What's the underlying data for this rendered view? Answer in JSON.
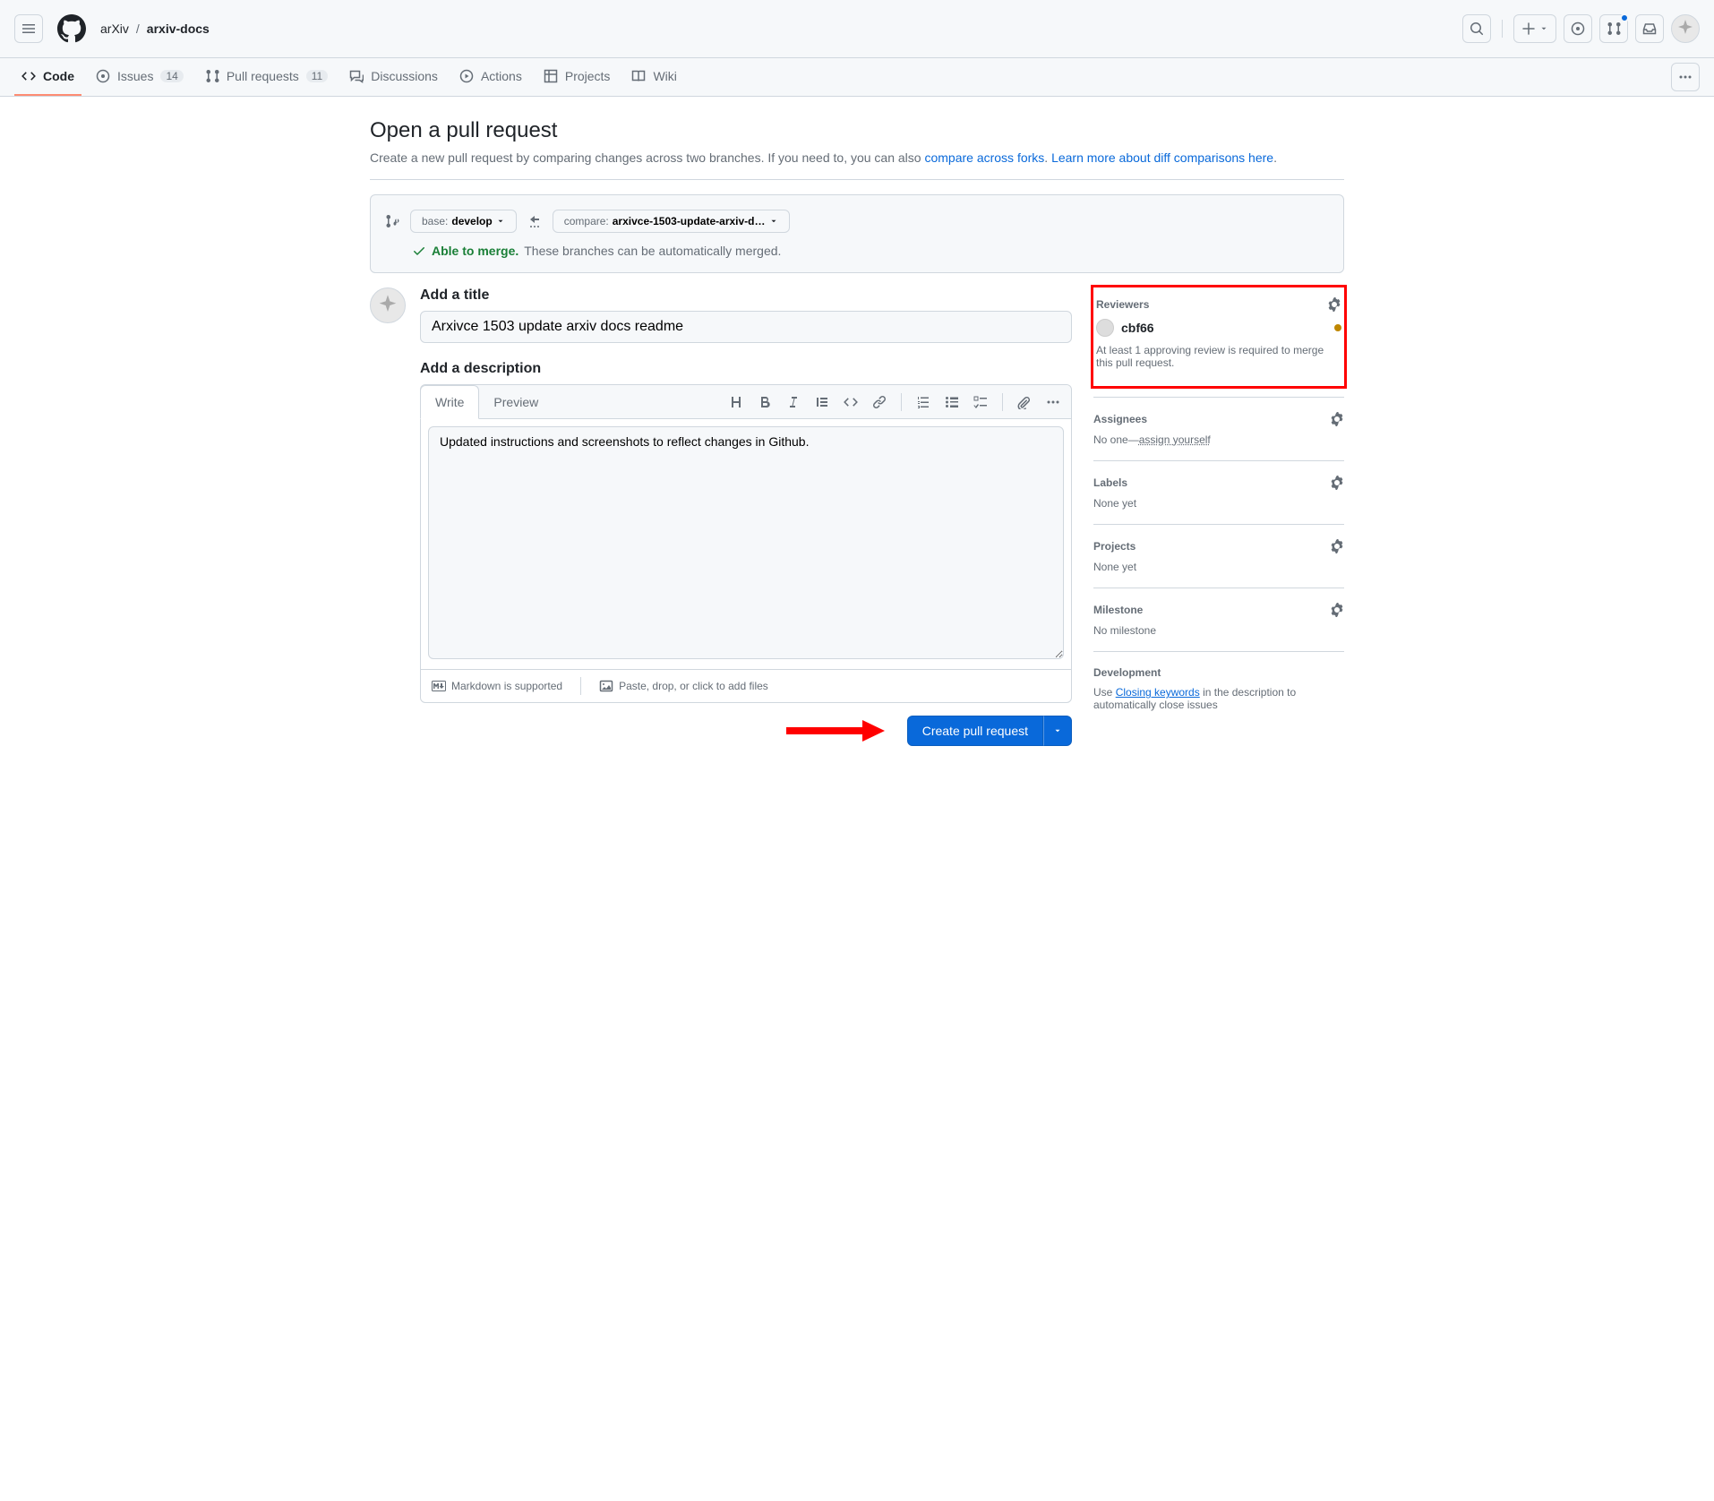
{
  "breadcrumb": {
    "owner": "arXiv",
    "repo": "arxiv-docs",
    "sep": "/"
  },
  "nav": {
    "code": "Code",
    "issues": "Issues",
    "issuesCount": "14",
    "pulls": "Pull requests",
    "pullsCount": "11",
    "discussions": "Discussions",
    "actions": "Actions",
    "projects": "Projects",
    "wiki": "Wiki"
  },
  "page": {
    "title": "Open a pull request",
    "subtitlePrefix": "Create a new pull request by comparing changes across two branches. If you need to, you can also ",
    "compareLink": "compare across forks",
    "subtitleMid": ". ",
    "learnLink": "Learn more about diff comparisons here",
    "subtitleEnd": "."
  },
  "compare": {
    "baseLabel": "base: ",
    "baseValue": "develop",
    "compareLabel": "compare: ",
    "compareValue": "arxivce-1503-update-arxiv-d…",
    "able": "Able to merge.",
    "desc": "These branches can be automatically merged."
  },
  "form": {
    "titleLabel": "Add a title",
    "titleValue": "Arxivce 1503 update arxiv docs readme",
    "descLabel": "Add a description",
    "writeTab": "Write",
    "previewTab": "Preview",
    "descValue": "Updated instructions and screenshots to reflect changes in Github.",
    "mdSupport": "Markdown is supported",
    "dropFiles": "Paste, drop, or click to add files",
    "submit": "Create pull request"
  },
  "side": {
    "reviewers": {
      "title": "Reviewers",
      "user": "cbf66",
      "note": "At least 1 approving review is required to merge this pull request."
    },
    "assignees": {
      "title": "Assignees",
      "prefix": "No one—",
      "link": "assign yourself"
    },
    "labels": {
      "title": "Labels",
      "none": "None yet"
    },
    "projects": {
      "title": "Projects",
      "none": "None yet"
    },
    "milestone": {
      "title": "Milestone",
      "none": "No milestone"
    },
    "development": {
      "title": "Development",
      "prefix": "Use ",
      "link": "Closing keywords",
      "suffix": " in the description to automatically close issues"
    }
  }
}
